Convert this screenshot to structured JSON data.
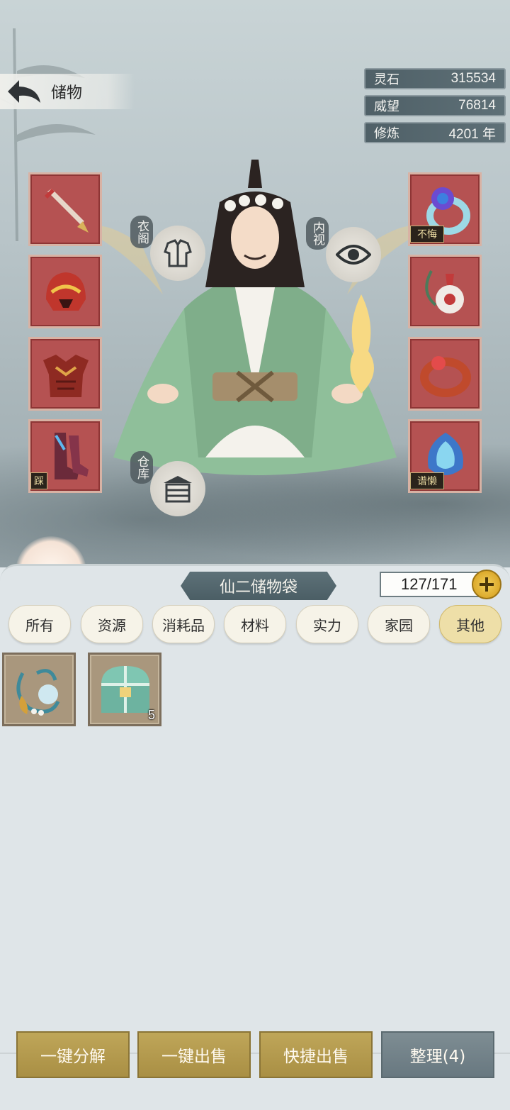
{
  "header": {
    "title": "储物"
  },
  "resources": [
    {
      "name": "灵石",
      "value": "315534"
    },
    {
      "name": "威望",
      "value": "76814"
    },
    {
      "name": "修炼",
      "value": "4201 年"
    }
  ],
  "side_buttons": {
    "wardrobe": "衣阁",
    "inner_view": "内视",
    "warehouse": "仓库"
  },
  "equipment_left": [
    {
      "icon": "sword-icon",
      "seal": ""
    },
    {
      "icon": "helmet-icon",
      "seal": ""
    },
    {
      "icon": "armor-icon",
      "seal": ""
    },
    {
      "icon": "boots-icon",
      "seal": "踩"
    }
  ],
  "equipment_right": [
    {
      "icon": "ring-icon",
      "seal": "不悔"
    },
    {
      "icon": "pendant-icon",
      "seal": ""
    },
    {
      "icon": "bracelet-icon",
      "seal": ""
    },
    {
      "icon": "talisman-icon",
      "seal": "谱懒"
    }
  ],
  "bag": {
    "title": "仙二储物袋",
    "capacity": "127/171"
  },
  "tabs": [
    "所有",
    "资源",
    "消耗品",
    "材料",
    "实力",
    "家园",
    "其他"
  ],
  "active_tab": "其他",
  "items": [
    {
      "icon": "necklace-icon",
      "count": ""
    },
    {
      "icon": "treasure-chest-icon",
      "count": "5"
    }
  ],
  "actions": {
    "decompose": "一键分解",
    "sell_all": "一键出售",
    "quick_sell": "快捷出售",
    "sort": "整理(4)"
  },
  "colors": {
    "slot_red": "#b55252",
    "gold_button": "#bfa659",
    "grey_button": "#7e8d93",
    "robe_green": "#8fbf9a"
  }
}
